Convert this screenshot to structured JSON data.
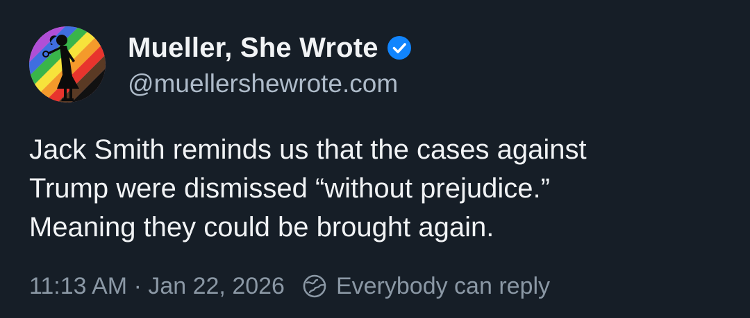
{
  "author": {
    "display_name": "Mueller, She Wrote",
    "handle": "@muellershewrote.com",
    "verified": true,
    "avatar_icon": "rainbow-silhouette-avatar"
  },
  "post": {
    "lines": [
      "Jack Smith reminds us that the cases against",
      "Trump were dismissed “without prejudice.”",
      "Meaning they could be brought again."
    ]
  },
  "meta": {
    "timestamp": "11:13 AM · Jan 22, 2026",
    "reply_icon": "reply-settings-icon",
    "reply_setting": "Everybody can reply"
  },
  "colors": {
    "background": "#161e27",
    "verified_badge": "#1185fe",
    "text_primary": "#f1f3f5",
    "text_secondary": "#8b98a5"
  }
}
